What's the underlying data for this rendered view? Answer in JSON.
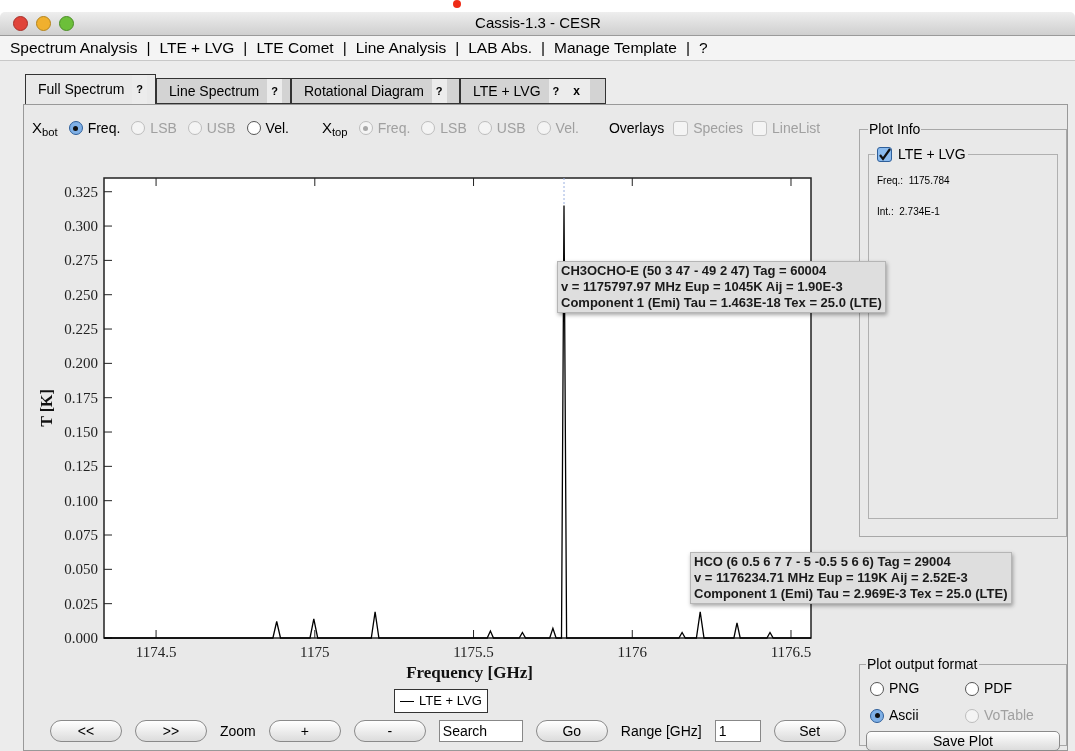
{
  "window": {
    "title": "Cassis-1.3 - CESR"
  },
  "menu": {
    "separator": "|",
    "items": [
      "Spectrum Analysis",
      "LTE + LVG",
      "LTE Comet",
      "Line Analysis",
      "LAB Abs.",
      "Manage Template",
      "?"
    ]
  },
  "tabs": [
    {
      "label": "Full Spectrum",
      "help": "?",
      "selected": true
    },
    {
      "label": "Line Spectrum",
      "help": "?",
      "selected": false
    },
    {
      "label": "Rotational Diagram",
      "help": "?",
      "selected": false
    },
    {
      "label": "LTE + LVG",
      "help": "?",
      "close": "x",
      "selected": false
    }
  ],
  "axis_options": [
    {
      "label": "X$_{bot}$",
      "options": [
        {
          "label": "Freq.",
          "selected": true,
          "disabled": false
        },
        {
          "label": "LSB",
          "selected": false,
          "disabled": true
        },
        {
          "label": "USB",
          "selected": false,
          "disabled": true
        },
        {
          "label": "Vel.",
          "selected": false,
          "disabled": false
        }
      ]
    },
    {
      "label": "X$_{top}$",
      "options": [
        {
          "label": "Freq.",
          "selected": true,
          "disabled": true
        },
        {
          "label": "LSB",
          "selected": false,
          "disabled": true
        },
        {
          "label": "USB",
          "selected": false,
          "disabled": true
        },
        {
          "label": "Vel.",
          "selected": false,
          "disabled": true
        }
      ]
    }
  ],
  "overlays": {
    "label": "Overlays",
    "options": [
      {
        "label": "Species",
        "checked": false,
        "disabled": true
      },
      {
        "label": "LineList",
        "checked": false,
        "disabled": true
      }
    ]
  },
  "chart": {
    "chart_data": {
      "type": "line",
      "xlabel": "Frequency [GHz]",
      "ylabel": "T [K]",
      "xlim": [
        1174.336,
        1176.563
      ],
      "ylim": [
        0,
        0.335
      ],
      "xticks": [
        1174.5,
        1175,
        1175.5,
        1176,
        1176.5
      ],
      "yticks": [
        {
          "value": 0,
          "label": "0.000"
        },
        {
          "value": 0.025,
          "label": "0.025"
        },
        {
          "value": 0.05,
          "label": "0.050"
        },
        {
          "value": 0.075,
          "label": "0.075"
        },
        {
          "value": 0.1,
          "label": "0.100"
        },
        {
          "value": 0.125,
          "label": "0.125"
        },
        {
          "value": 0.15,
          "label": "0.150"
        },
        {
          "value": 0.175,
          "label": "0.175"
        },
        {
          "value": 0.2,
          "label": "0.200"
        },
        {
          "value": 0.225,
          "label": "0.225"
        },
        {
          "value": 0.25,
          "label": "0.250"
        },
        {
          "value": 0.275,
          "label": "0.275"
        },
        {
          "value": 0.3,
          "label": "0.300"
        },
        {
          "value": 0.325,
          "label": "0.325"
        }
      ],
      "x": [
        1174.336,
        1174.868,
        1174.88,
        1174.892,
        1174.985,
        1174.997,
        1175.009,
        1175.178,
        1175.19,
        1175.202,
        1175.543,
        1175.553,
        1175.563,
        1175.644,
        1175.654,
        1175.664,
        1175.74,
        1175.75,
        1175.76,
        1175.777,
        1175.785,
        1175.793,
        1176.147,
        1176.157,
        1176.167,
        1176.202,
        1176.214,
        1176.226,
        1176.32,
        1176.33,
        1176.34,
        1176.424,
        1176.434,
        1176.444,
        1176.563
      ],
      "series": [
        {
          "name": "LTE + LVG",
          "color": "#000000",
          "values": [
            0,
            0,
            0.012,
            0,
            0,
            0.014,
            0,
            0,
            0.019,
            0,
            0,
            0.005,
            0,
            0,
            0.004,
            0,
            0,
            0.007,
            0,
            0,
            0.315,
            0,
            0,
            0.004,
            0,
            0,
            0.019,
            0,
            0,
            0.011,
            0,
            0,
            0.004,
            0,
            0
          ]
        }
      ]
    }
  },
  "tooltips": [
    {
      "lines": [
        "CH3OCHO-E (50 3 47 - 49 2 47) Tag = 60004",
        "v = 1175797.97 MHz Eup = 1045K Aij = 1.90E-3",
        "Component 1 (Emi) Tau = 1.463E-18 Tex = 25.0 (LTE)"
      ]
    },
    {
      "lines": [
        "HCO (6 0.5 6 7 7 - 5 -0.5 5 6 6) Tag = 29004",
        "v = 1176234.71 MHz Eup = 119K Aij = 2.52E-3",
        "Component 1 (Emi) Tau = 2.969E-3 Tex = 25.0 (LTE)"
      ]
    }
  ],
  "controls": [
    {
      "kind": "button",
      "label": "<<"
    },
    {
      "kind": "button",
      "label": ">>"
    },
    {
      "kind": "label",
      "label": "Zoom"
    },
    {
      "kind": "button",
      "label": "+"
    },
    {
      "kind": "button",
      "label": "-"
    },
    {
      "kind": "search",
      "value": "Search"
    },
    {
      "kind": "button",
      "label": "Go"
    },
    {
      "kind": "label",
      "label": "Range [GHz]"
    },
    {
      "kind": "number",
      "value": "1"
    },
    {
      "kind": "button",
      "label": "Set"
    }
  ],
  "plot_info": {
    "title": "Plot Info",
    "series": [
      {
        "label": "LTE + LVG",
        "checked": true,
        "fields": [
          {
            "label": "Freq.:",
            "value": "1175.784"
          },
          {
            "label": "Int.:",
            "value": "2.734E-1"
          }
        ]
      }
    ]
  },
  "output_format": {
    "title": "Plot output format",
    "options": [
      {
        "label": "PNG",
        "selected": false,
        "disabled": false
      },
      {
        "label": "PDF",
        "selected": false,
        "disabled": false
      },
      {
        "label": "Ascii",
        "selected": true,
        "disabled": false
      },
      {
        "label": "VoTable",
        "selected": false,
        "disabled": true
      }
    ],
    "button": "Save Plot"
  }
}
